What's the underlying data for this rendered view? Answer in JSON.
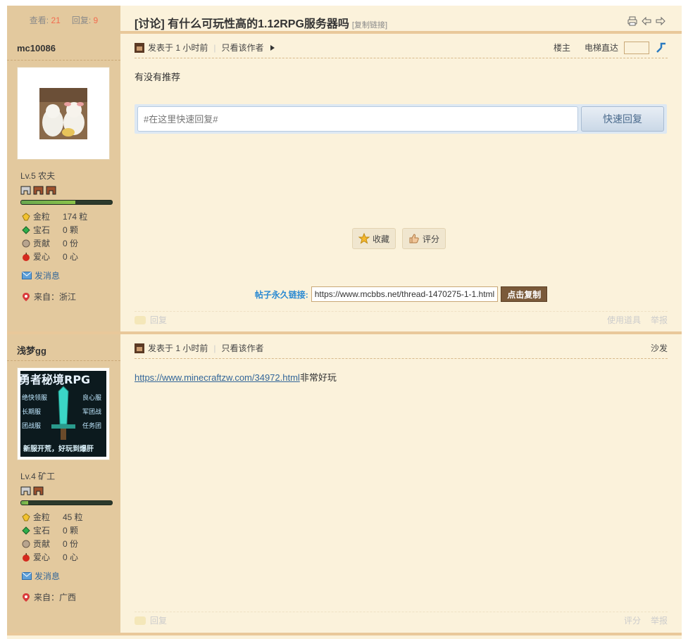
{
  "stats": {
    "views_label": "查看:",
    "views": "21",
    "replies_label": "回复:",
    "replies": "9"
  },
  "thread": {
    "title": "[讨论] 有什么可玩性高的1.12RPG服务器吗",
    "copy_link": "[复制链接]"
  },
  "post1": {
    "author": "mc10086",
    "level": "Lv.5 农夫",
    "stats": [
      {
        "label": "金粒",
        "value": "174 粒",
        "icon": "gold-nugget-icon",
        "color": "#f2c230"
      },
      {
        "label": "宝石",
        "value": "0 颗",
        "icon": "emerald-icon",
        "color": "#2fae4a"
      },
      {
        "label": "贡献",
        "value": "0 份",
        "icon": "contribution-icon",
        "color": "#8a7a6a"
      },
      {
        "label": "爱心",
        "value": "0 心",
        "icon": "apple-icon",
        "color": "#d42a1e"
      }
    ],
    "send_msg": "发消息",
    "from": "来自：浙江",
    "posted": "发表于 1 小时前",
    "only_author": "只看该作者",
    "floor_label": "楼主",
    "jump_label": "电梯直达",
    "content": "有没有推荐",
    "quick_reply_placeholder": "#在这里快速回复#",
    "quick_reply_button": "快速回复",
    "favorite": "收藏",
    "rate": "评分",
    "permalink_label": "帖子永久链接:",
    "permalink_url": "https://www.mcbbs.net/thread-1470275-1-1.html",
    "permalink_copy": "点击复制",
    "foot_reply": "回复",
    "foot_tools": "使用道具",
    "foot_report": "举报",
    "exp_progress": 0.6
  },
  "post2": {
    "author": "浅梦gg",
    "level": "Lv.4 矿工",
    "stats": [
      {
        "label": "金粒",
        "value": "45 粒",
        "icon": "gold-nugget-icon",
        "color": "#f2c230"
      },
      {
        "label": "宝石",
        "value": "0 颗",
        "icon": "emerald-icon",
        "color": "#2fae4a"
      },
      {
        "label": "贡献",
        "value": "0 份",
        "icon": "contribution-icon",
        "color": "#8a7a6a"
      },
      {
        "label": "爱心",
        "value": "0 心",
        "icon": "apple-icon",
        "color": "#d42a1e"
      }
    ],
    "send_msg": "发消息",
    "from": "来自：广西",
    "posted": "发表于 1 小时前",
    "only_author": "只看该作者",
    "floor_label": "沙发",
    "content_link": "https://www.minecraftzw.com/34972.html",
    "content_text": "非常好玩",
    "avatar_banner": {
      "title": "勇者秘境RPG",
      "left_tags": [
        "绝快领服",
        "长期服",
        "团战服"
      ],
      "right_tags": [
        "良心服",
        "军团战",
        "任务团"
      ],
      "bottom": "新服开荒，好玩到爆肝"
    },
    "foot_reply": "回复",
    "foot_rate": "评分",
    "foot_report": "举报",
    "exp_progress": 0.08
  }
}
